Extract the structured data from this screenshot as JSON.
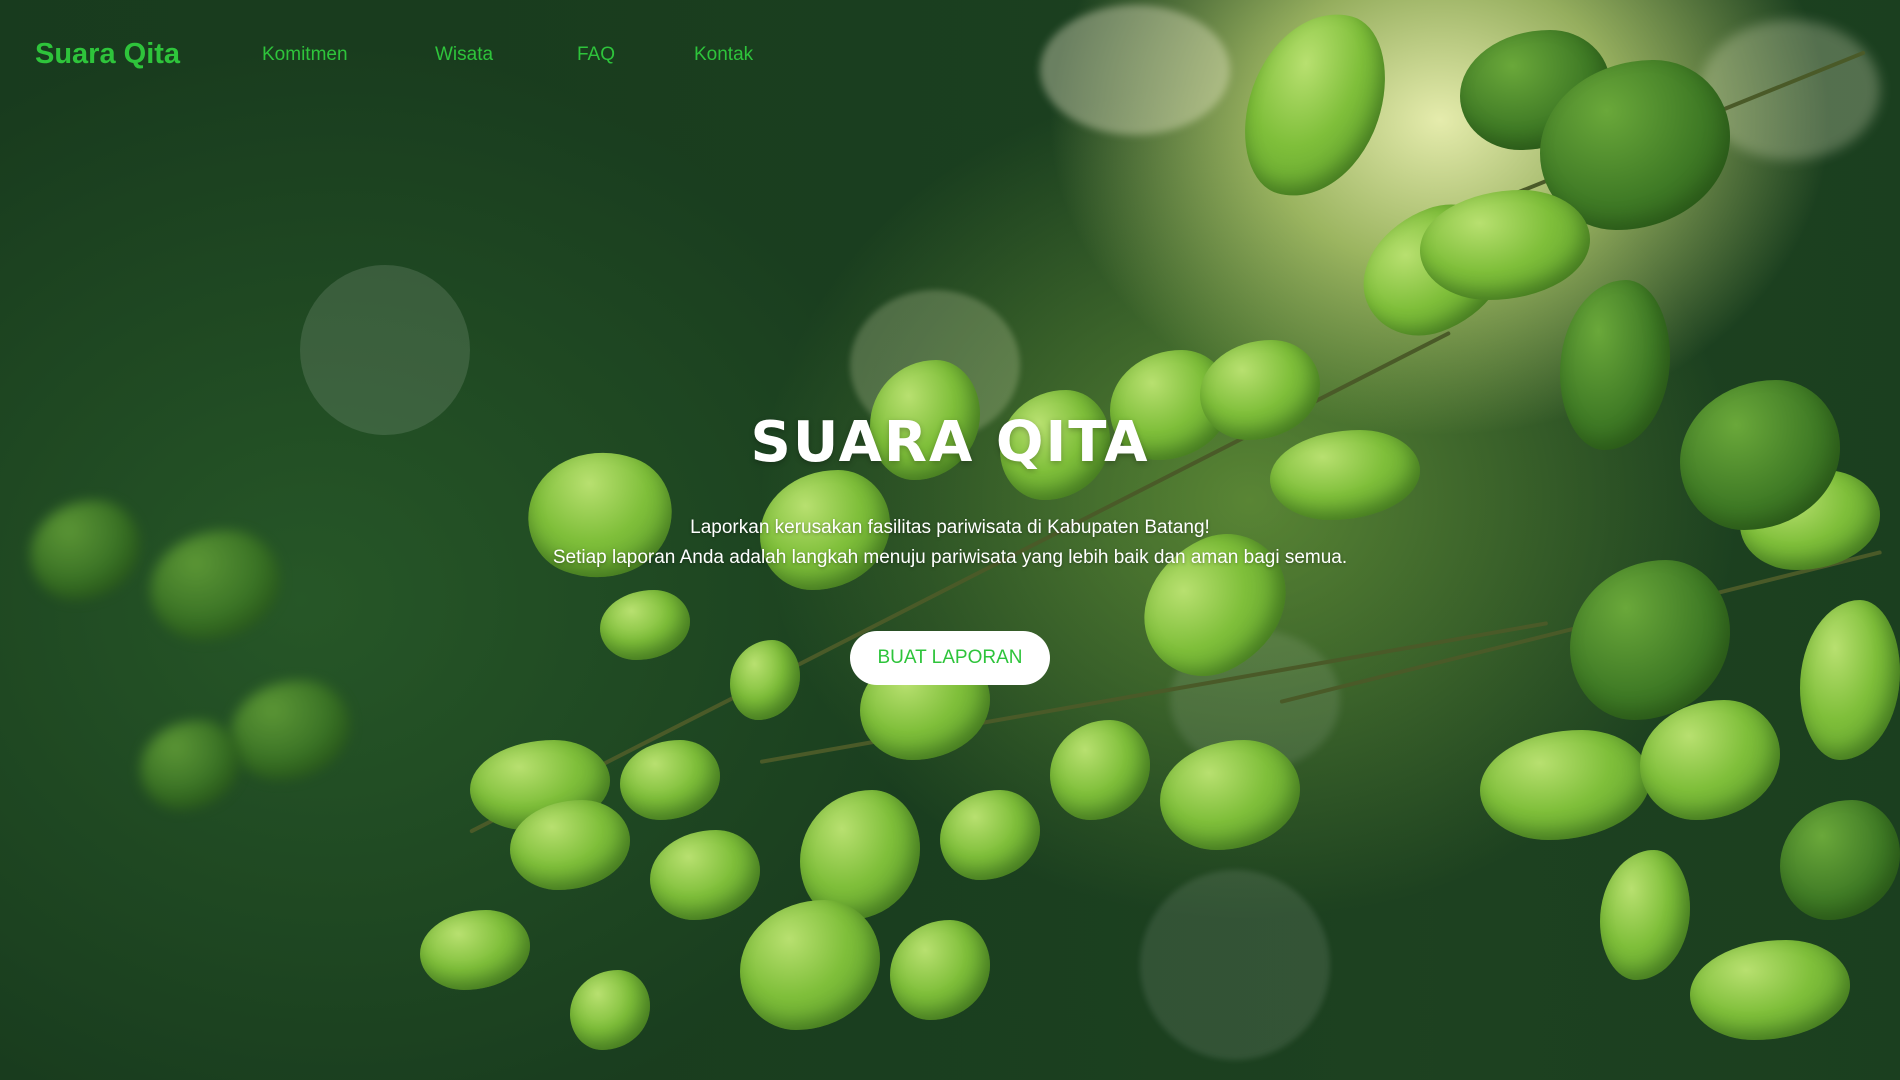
{
  "nav": {
    "brand": "Suara Qita",
    "links": [
      "Komitmen",
      "Wisata",
      "FAQ",
      "Kontak"
    ]
  },
  "hero": {
    "title": "SUARA QITA",
    "subtitle_line1": "Laporkan kerusakan fasilitas pariwisata di Kabupaten Batang!",
    "subtitle_line2": "Setiap laporan Anda adalah langkah menuju pariwisata yang lebih baik dan aman bagi semua.",
    "cta_label": "BUAT LAPORAN"
  },
  "colors": {
    "accent": "#2ec43b",
    "button_bg": "#ffffff",
    "text_light": "#ffffff"
  }
}
